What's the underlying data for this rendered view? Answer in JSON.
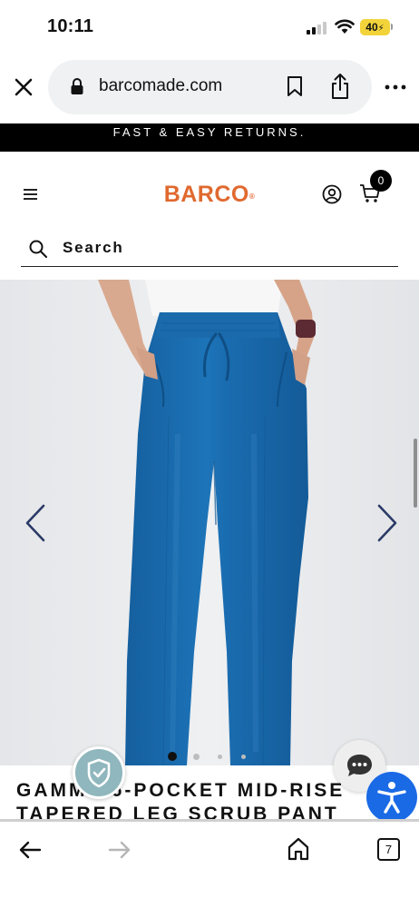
{
  "status_bar": {
    "time": "10:11",
    "battery": "40"
  },
  "browser": {
    "url": "barcomade.com",
    "tab_count": "7"
  },
  "promo_banner": {
    "text": "FAST & EASY RETURNS."
  },
  "header": {
    "logo": "BARCO",
    "logo_mark": "®",
    "cart_count": "0"
  },
  "search": {
    "label": "Search"
  },
  "gallery": {
    "total_images": 4,
    "active_index": 0,
    "pant_color": "#1b6fb1"
  },
  "product": {
    "title_line1": "GAMMA 6-POCKET MID-RISE",
    "title_line2": "TAPERED LEG SCRUB PANT"
  },
  "colors": {
    "brand_orange": "#e0692f",
    "accessibility_blue": "#1a6ae6",
    "promo_black": "#000000"
  }
}
